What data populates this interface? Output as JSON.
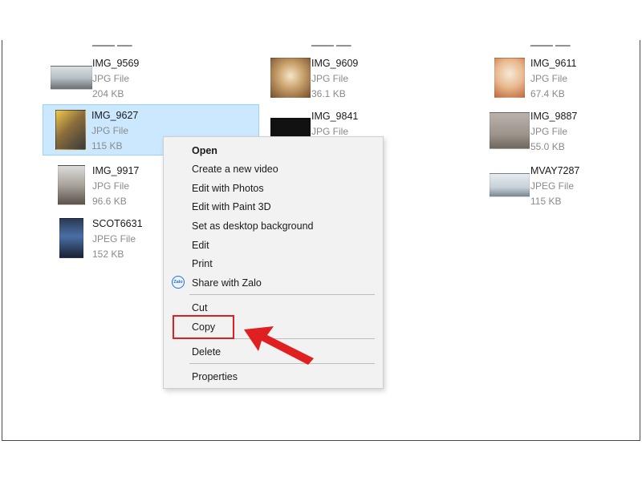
{
  "files": [
    {
      "name": "IMG_9569",
      "type": "JPG File",
      "size": "204 KB"
    },
    {
      "name": "IMG_9609",
      "type": "JPG File",
      "size": "36.1 KB"
    },
    {
      "name": "IMG_9611",
      "type": "JPG File",
      "size": "67.4 KB"
    },
    {
      "name": "IMG_9627",
      "type": "JPG File",
      "size": "115 KB"
    },
    {
      "name": "IMG_9841",
      "type": "JPG File",
      "size": ""
    },
    {
      "name": "IMG_9887",
      "type": "JPG File",
      "size": "55.0 KB"
    },
    {
      "name": "IMG_9917",
      "type": "JPG File",
      "size": "96.6 KB"
    },
    {
      "name": "MVAY7287",
      "type": "JPEG File",
      "size": "115 KB"
    },
    {
      "name": "SCOT6631",
      "type": "JPEG File",
      "size": "152 KB"
    }
  ],
  "context_menu": {
    "open": "Open",
    "create_video": "Create a new video",
    "edit_photos": "Edit with Photos",
    "edit_paint3d": "Edit with Paint 3D",
    "set_background": "Set as desktop background",
    "edit": "Edit",
    "print": "Print",
    "share_zalo": "Share with Zalo",
    "zalo_icon_text": "Zalo",
    "cut": "Cut",
    "copy": "Copy",
    "delete": "Delete",
    "properties": "Properties"
  },
  "colors": {
    "selection": "#cce8ff",
    "highlight": "#e02020",
    "zalo": "#1a73e8"
  }
}
